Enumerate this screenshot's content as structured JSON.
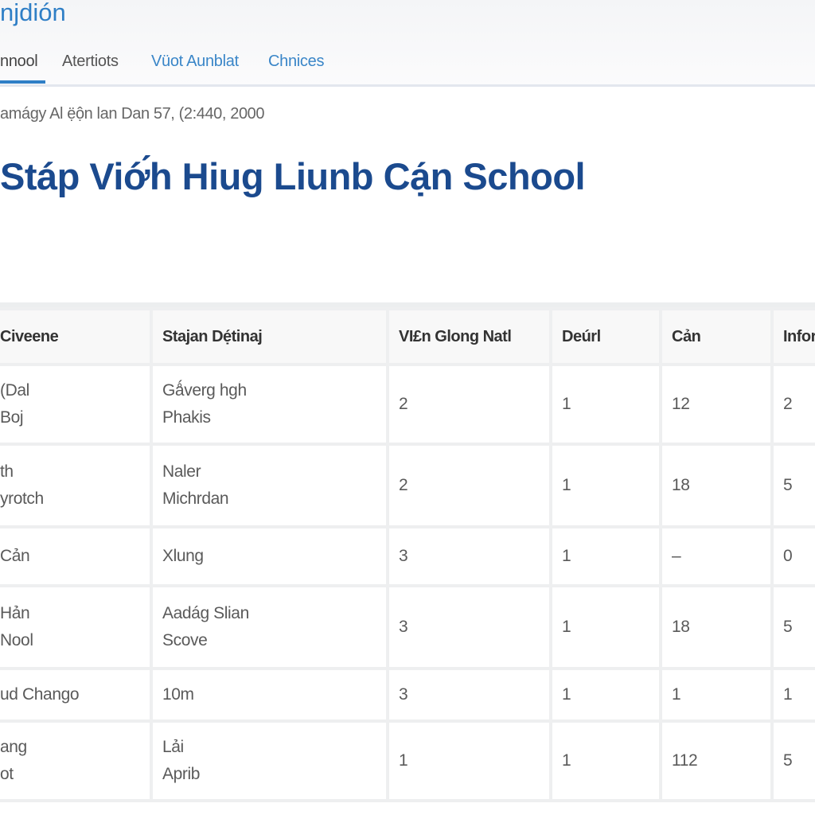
{
  "header": {
    "brand": "njdión",
    "tabs": [
      {
        "label": "nnool",
        "active": true
      },
      {
        "label": "Atertiots",
        "active": false
      },
      {
        "label": "Vüot Aunblat",
        "active": false
      },
      {
        "label": "Chnices",
        "active": false
      }
    ]
  },
  "main": {
    "meta": "amágy Al ẹ̈ộn lan Dan 57, (2:440, 2000",
    "title": "Stáp Viớ́h Hiug Liunb Cạ́n School",
    "table": {
      "columns": [
        "Civeene",
        "Stajan Dẹ́tinaj",
        "VI£n Glong Natl",
        "Deúrl",
        "Cản",
        "Infor"
      ],
      "rows": [
        [
          "(Dal\nBoj",
          "Gǻverg hgh\nPhakis",
          "2",
          "1",
          "12",
          "2"
        ],
        [
          "th\nyrotch",
          "Naler\nMichrdan",
          "2",
          "1",
          "18",
          "5"
        ],
        [
          "Cản",
          "Xlung",
          "3",
          "1",
          "–",
          "0"
        ],
        [
          "Hản\nNool",
          "Aadág Slian\nScove",
          "3",
          "1",
          "18",
          "5"
        ],
        [
          "ud Chango",
          "10m",
          "3",
          "1",
          "1",
          "1"
        ],
        [
          "ang\not",
          "Lải\nAprib",
          "1",
          "1",
          "112",
          "5"
        ]
      ]
    }
  },
  "colors": {
    "accent": "#2f7fc6",
    "title": "#1b4a8e"
  }
}
